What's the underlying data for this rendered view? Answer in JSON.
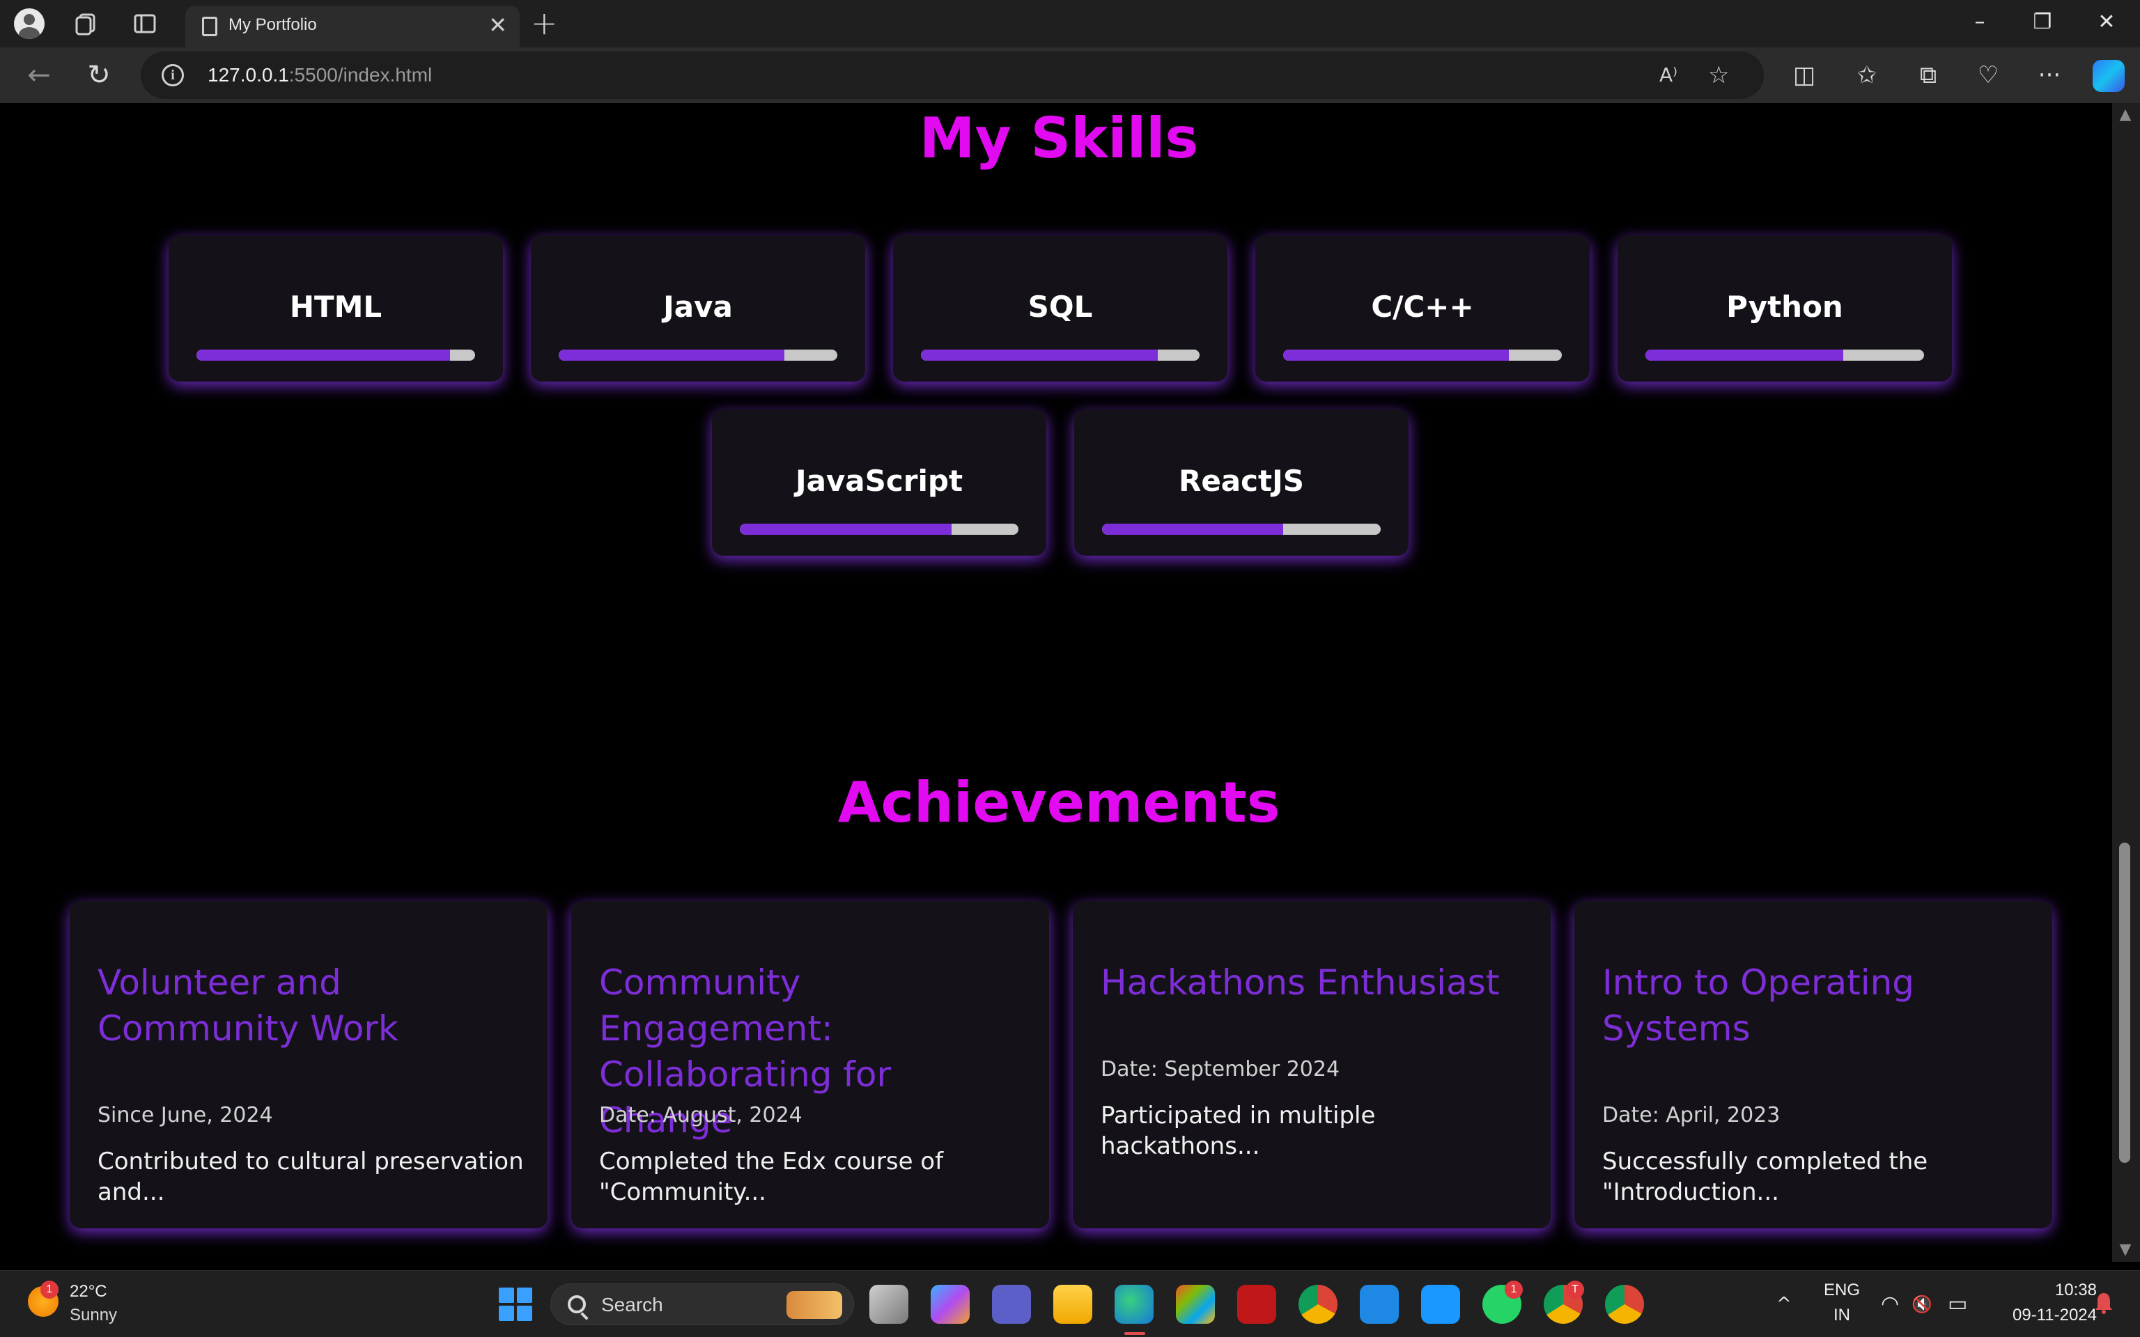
{
  "browser": {
    "tab_title": "My Portfolio",
    "tab_close": "✕",
    "new_tab": "+",
    "url_host": "127.0.0.1",
    "url_rest": ":5500/index.html",
    "read_aloud": "A⁾",
    "favorite": "☆",
    "minimize": "–",
    "restore": "❐",
    "close": "✕",
    "back": "←",
    "reload": "↻",
    "info": "i",
    "split_screen": "◫",
    "favorites": "✩",
    "collections": "⧉",
    "health": "♡",
    "more": "···"
  },
  "skills": {
    "title": "My Skills",
    "items": [
      {
        "name": "HTML",
        "level": 0.91
      },
      {
        "name": "Java",
        "level": 0.81
      },
      {
        "name": "SQL",
        "level": 0.85
      },
      {
        "name": "C/C++",
        "level": 0.81
      },
      {
        "name": "Python",
        "level": 0.71
      },
      {
        "name": "JavaScript",
        "level": 0.76
      },
      {
        "name": "ReactJS",
        "level": 0.65
      }
    ],
    "fill_color": "#7e2ed8",
    "track_color": "#c8c8c8"
  },
  "achievements": {
    "title": "Achievements",
    "items": [
      {
        "title": "Volunteer and Community Work",
        "date": "Since June, 2024",
        "desc": "Contributed to cultural preservation and..."
      },
      {
        "title": "Community Engagement: Collaborating for Change",
        "date": "Date: August, 2024",
        "desc": "Completed the Edx course of \"Community..."
      },
      {
        "title": "Hackathons Enthusiast",
        "date": "Date: September 2024",
        "desc": "Participated in multiple hackathons..."
      },
      {
        "title": "Intro to Operating Systems",
        "date": "Date: April, 2023",
        "desc": "Successfully completed the \"Introduction..."
      }
    ]
  },
  "colors": {
    "accent_heading": "#e10af0",
    "accent_purple": "#7e2ed8",
    "card_bg": "#141218"
  },
  "taskbar": {
    "weather_badge": "1",
    "weather_temp": "22°C",
    "weather_cond": "Sunny",
    "search_label": "Search",
    "whatsapp_badge": "1",
    "chrome_badge": "T",
    "lang_line1": "ENG",
    "lang_line2": "IN",
    "time": "10:38",
    "date": "09-11-2024",
    "tray_chevron": "^",
    "tray_wifi": "◠",
    "tray_volume": "🔇",
    "tray_battery": "▭"
  }
}
